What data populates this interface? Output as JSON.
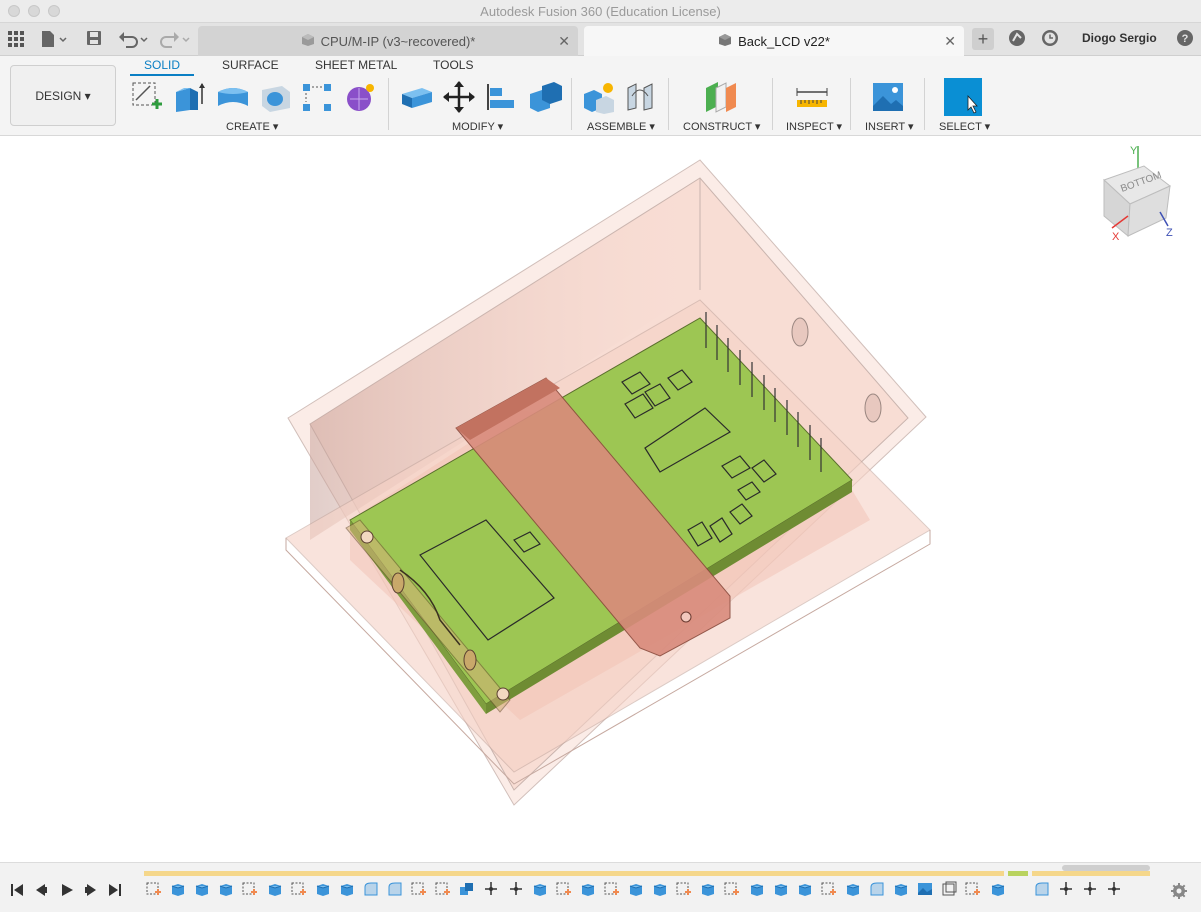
{
  "window": {
    "title": "Autodesk Fusion 360 (Education License)"
  },
  "tabs": [
    {
      "label": "CPU/M-IP (v3~recovered)*",
      "active": false
    },
    {
      "label": "Back_LCD v22*",
      "active": true
    }
  ],
  "user": {
    "name": "Diogo Sergio"
  },
  "ribbon": {
    "workspace": "DESIGN ▾",
    "tabs": [
      "SOLID",
      "SURFACE",
      "SHEET METAL",
      "TOOLS"
    ],
    "groups": {
      "create": "CREATE ▾",
      "modify": "MODIFY ▾",
      "assemble": "ASSEMBLE ▾",
      "construct": "CONSTRUCT ▾",
      "inspect": "INSPECT ▾",
      "insert": "INSERT ▾",
      "select": "SELECT ▾"
    }
  },
  "viewcube": {
    "face": "BOTTOM",
    "axes": [
      "X",
      "Y",
      "Z"
    ]
  },
  "colors": {
    "accent": "#0a7fc4",
    "pcb": "#9dc653",
    "enclosure": "#f6d2c6",
    "strap": "#d98b7c",
    "timeline_bar": "#f5d78b"
  },
  "icons": {
    "apps": "grid-icon",
    "file": "file-icon",
    "save": "save-icon",
    "undo": "undo-icon",
    "redo": "redo-icon",
    "new_tab": "plus-icon",
    "extensions": "extensions-icon",
    "job_status": "clock-icon",
    "settings": "gear-icon"
  }
}
